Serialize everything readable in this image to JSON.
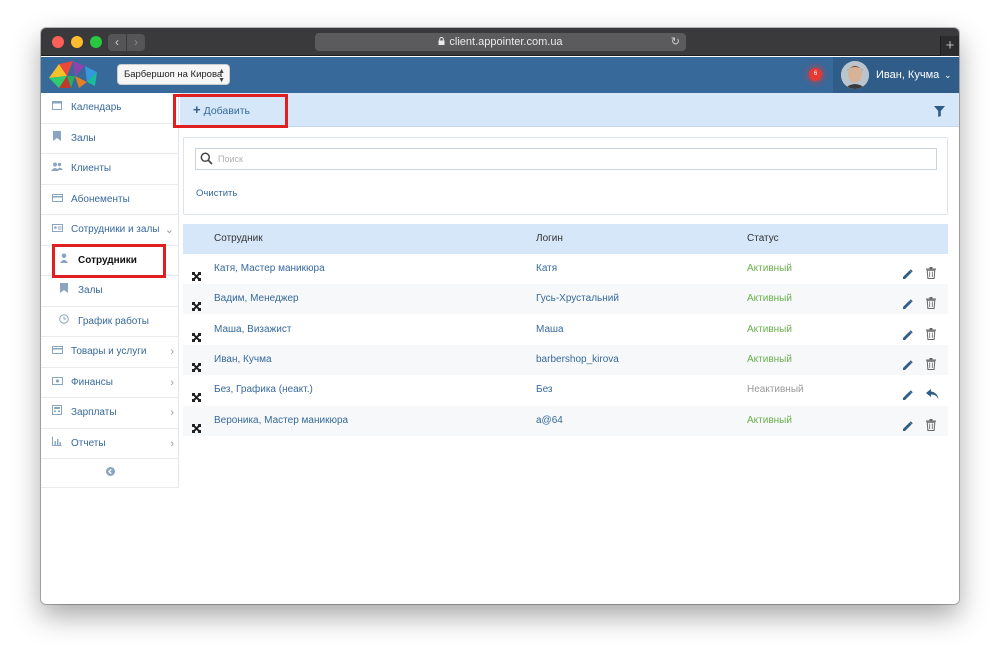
{
  "browser": {
    "url": "client.appointer.com.ua",
    "back_glyph": "‹",
    "forward_glyph": "›",
    "new_tab_glyph": "+"
  },
  "header": {
    "branch_select": "Барбершоп на Кирова",
    "notification_count": "6",
    "user_name": "Иван, Кучма"
  },
  "sidebar": {
    "items": [
      {
        "label": "Календарь",
        "icon": "calendar-icon"
      },
      {
        "label": "Залы",
        "icon": "bookmark-icon"
      },
      {
        "label": "Клиенты",
        "icon": "users-icon"
      },
      {
        "label": "Абонементы",
        "icon": "credit-card-icon"
      },
      {
        "label": "Сотрудники и залы",
        "icon": "id-card-icon",
        "expanded": true
      },
      {
        "label": "Сотрудники",
        "icon": "user-icon",
        "active": true
      },
      {
        "label": "Залы",
        "icon": "bookmark-icon"
      },
      {
        "label": "График работы",
        "icon": "clock-icon"
      },
      {
        "label": "Товары и услуги",
        "icon": "credit-card-icon"
      },
      {
        "label": "Финансы",
        "icon": "money-icon"
      },
      {
        "label": "Зарплаты",
        "icon": "calculator-icon"
      },
      {
        "label": "Отчеты",
        "icon": "bar-chart-icon"
      }
    ]
  },
  "toolbar": {
    "add_label": "Добавить"
  },
  "filter": {
    "search_placeholder": "Поиск",
    "clear_label": "Очистить"
  },
  "table": {
    "columns": [
      "Сотрудник",
      "Логин",
      "Статус"
    ],
    "rows": [
      {
        "name": "Катя, Мастер маникюра",
        "login": "Катя",
        "status": "Активный",
        "active": true
      },
      {
        "name": "Вадим, Менеджер",
        "login": "Гусь-Хрустальний",
        "status": "Активный",
        "active": true
      },
      {
        "name": "Маша, Визажист",
        "login": "Маша",
        "status": "Активный",
        "active": true
      },
      {
        "name": "Иван, Кучма",
        "login": "barbershop_kirova",
        "status": "Активный",
        "active": true
      },
      {
        "name": "Без, Графика (неакт.)",
        "login": "Без",
        "status": "Неактивный",
        "active": false
      },
      {
        "name": "Вероника, Мастер маникюра",
        "login": "a@64",
        "status": "Активный",
        "active": true
      }
    ]
  },
  "colors": {
    "header": "#37699b",
    "link": "#37699b",
    "active_status": "#6ab04c",
    "highlight": "#e02020",
    "toolbar_bg": "#d5e7f8"
  }
}
